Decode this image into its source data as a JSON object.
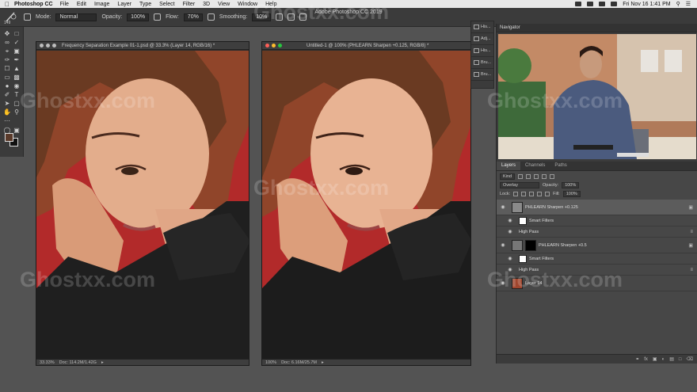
{
  "menubar": {
    "app_name": "Photoshop CC",
    "items": [
      "File",
      "Edit",
      "Image",
      "Layer",
      "Type",
      "Select",
      "Filter",
      "3D",
      "View",
      "Window",
      "Help"
    ],
    "clock": "Fri Nov 16  1:41 PM"
  },
  "window_title": "Adobe Photoshop CC 2019",
  "options_bar": {
    "brush_size": "149",
    "mode_label": "Mode:",
    "mode_value": "Normal",
    "opacity_label": "Opacity:",
    "opacity_value": "100%",
    "flow_label": "Flow:",
    "flow_value": "70%",
    "smoothing_label": "Smoothing:",
    "smoothing_value": "10%"
  },
  "doc_left": {
    "title": "Frequency Separation Example 01-1.psd @ 33.3% (Layer 14, RGB/16) *",
    "zoom": "33.33%",
    "doc_size": "Doc: 114.2M/1.42G"
  },
  "doc_right": {
    "title": "Untitled-1 @ 100% (PHLEARN Sharpen +0.125, RGB/8) *",
    "zoom": "100%",
    "doc_size": "Doc: 6.16M/25.7M"
  },
  "mini_panels": [
    "His...",
    "Adj...",
    "His...",
    "Bru...",
    "Bru..."
  ],
  "navigator": {
    "title": "Navigator"
  },
  "layers_panel": {
    "tabs": [
      "Layers",
      "Channels",
      "Paths"
    ],
    "kind_label": "Kind",
    "blend_mode": "Overlay",
    "opacity_label": "Opacity:",
    "opacity_value": "100%",
    "lock_label": "Lock:",
    "fill_label": "Fill:",
    "fill_value": "100%",
    "layers": [
      {
        "name": "PHLEARN Sharpen +0.125"
      },
      {
        "name": "Smart Filters"
      },
      {
        "name": "High Pass"
      },
      {
        "name": "PHLEARN Sharpen +0.5"
      },
      {
        "name": "Smart Filters"
      },
      {
        "name": "High Pass"
      },
      {
        "name": "Layer 14"
      }
    ],
    "footer_icons": [
      "link-icon",
      "fx-icon",
      "mask-icon",
      "adjustment-icon",
      "group-icon",
      "new-layer-icon",
      "trash-icon"
    ]
  },
  "watermarks": [
    "Ghostxx.com",
    "Ghostxx.com",
    "Ghostxx.com",
    "Ghostxx.com",
    "Ghostxx.com",
    "Ghostxx.com"
  ],
  "colors": {
    "ui_dark": "#3b3b3b",
    "workspace": "#535353",
    "backdrop_red": "#b22a2a",
    "sweater": "#1f1f1f",
    "skin": "#e3ad8c"
  }
}
